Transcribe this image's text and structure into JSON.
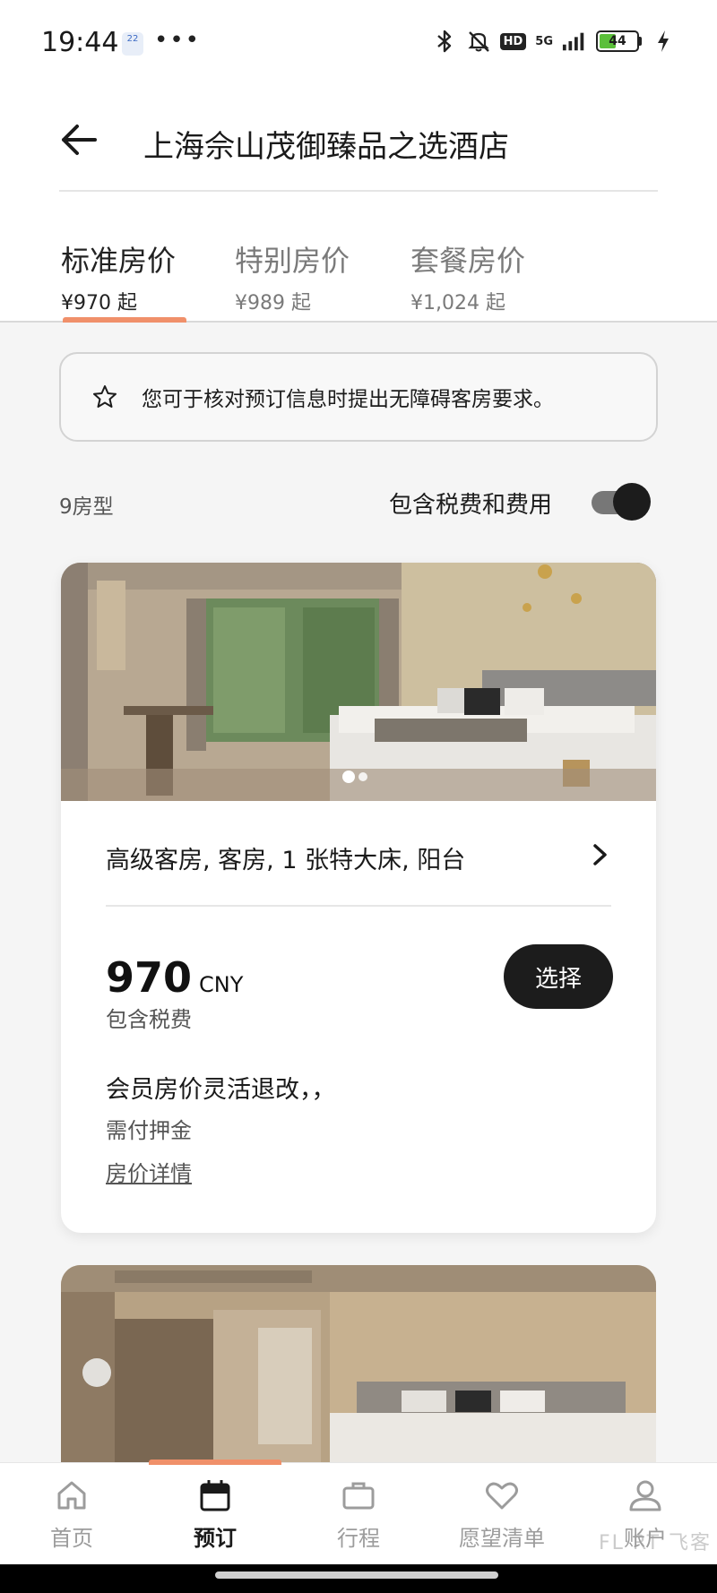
{
  "status_bar": {
    "time": "19:44",
    "date_badge": "22",
    "more": "•••",
    "hd": "HD",
    "network": "5G",
    "battery": "44"
  },
  "header": {
    "title": "上海佘山茂御臻品之选酒店"
  },
  "rate_tabs": [
    {
      "title": "标准房价",
      "price": "¥970 起",
      "active": true
    },
    {
      "title": "特别房价",
      "price": "¥989 起",
      "active": false
    },
    {
      "title": "套餐房价",
      "price": "¥1,024 起",
      "active": false
    }
  ],
  "notice": {
    "icon": "star-outline-icon",
    "text": "您可于核对预订信息时提出无障碍客房要求。"
  },
  "filters": {
    "room_count": "9房型",
    "tax_toggle_label": "包含税费和费用",
    "tax_toggle_on": true
  },
  "room_card": {
    "photo_index": 1,
    "photo_count": 2,
    "name": "高级客房, 客房, 1 张特大床, 阳台",
    "price": "970",
    "currency": "CNY",
    "tax_note": "包含税费",
    "select_label": "选择",
    "rate_name": "会员房价灵活退改，，",
    "deposit": "需付押金",
    "details_link": "房价详情"
  },
  "bottom_nav": [
    {
      "label": "首页",
      "icon": "home-icon",
      "active": false
    },
    {
      "label": "预订",
      "icon": "calendar-icon",
      "active": true
    },
    {
      "label": "行程",
      "icon": "briefcase-icon",
      "active": false
    },
    {
      "label": "愿望清单",
      "icon": "heart-icon",
      "active": false
    },
    {
      "label": "账户",
      "icon": "user-icon",
      "active": false
    }
  ],
  "watermark": "FL·RT 飞客",
  "colors": {
    "accent": "#f0906a",
    "primary_button": "#1c1c1c",
    "battery_fill": "#5bbf3a"
  }
}
